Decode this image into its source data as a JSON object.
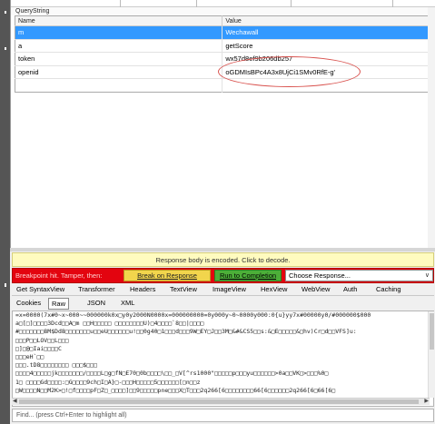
{
  "querystring": {
    "title": "QueryString",
    "columns": [
      "Name",
      "Value"
    ],
    "rows": [
      {
        "name": "m",
        "value": "Wechawall",
        "selected": true
      },
      {
        "name": "a",
        "value": "getScore",
        "selected": false
      },
      {
        "name": "token",
        "value": "wx57d8ef9b206db257",
        "selected": false
      },
      {
        "name": "openid",
        "value": "oGDMIsBPc4A3x8UjCi1SMv0RfE-g'",
        "selected": false
      }
    ]
  },
  "encoded_bar": {
    "label": "Response body is encoded. Click to decode."
  },
  "breakpoint": {
    "status_text": "Breakpoint hit. Tamper, then:",
    "break_label": "Break on Response",
    "run_label": "Run to Completion",
    "choose_label": "Choose Response..."
  },
  "tabs_row1": [
    "Get SyntaxView",
    "Transformer",
    "Headers",
    "TextView",
    "ImageView",
    "HexView",
    "WebView",
    "Auth",
    "Caching"
  ],
  "tabs_row2": [
    "Cookies",
    "Raw",
    "JSON",
    "XML"
  ],
  "selected_tab": "Raw",
  "raw_lines": [
    "=x=0000(7x#0~x~000~~000000k0x□y0y2000N0000x=000000000=0y000y~0~0000y000:0{u}yy7x#00000y0/#000000$000",
    "a□[□]□□□□3Dcd□□A□m □□H□□□□□ □□□□□□□□U)□4□□□□`8□□|□□□□",
    "#□□□□□□□8M$Dd8□□□□□□□u□□eU□□□□□□u!□□0g40□1□□□d□□□9W□EY□J□□3M□&#&CS5□□s:&□E□□□□□&□hv)Cr□d□□VFS]u:",
    "□□□P□□LOV□□L□□□",
    "□]□@□Iai□□□□C",
    "□□□eH`□□",
    "□□□.tD8□□□□□□□□ □□□$□□□",
    "□□□□4□□□□□jk□□□□□□□/□□□□L□g□fN□E70□0b□□□□\\□□_□V[^rs1000\"□□□□□p□□□yu□□□□□□>0a□□VK□>□□□%0□",
    "1□ □□□□Gd□□□□:□G□□□□9ch□I□A}□-□□□H□□□□□5□□□□□□[□n□□z",
    "□W□□□□N□□M2K>□!□f□□□□pF□Z□_□□□□]□□9□□□□□pne□□□X□T□□□2q266[6□□□□□□□□66[6□□□□□□2q266[6□66[6□"
  ],
  "findbar": {
    "placeholder": "Find... (press Ctrl+Enter to highlight all)"
  },
  "colors": {
    "selected_row": "#3399ff",
    "breakpoint_bar": "#e3040f",
    "break_button": "#f2d54c",
    "run_button": "#4caf38",
    "encoded_bar": "#fffbbf",
    "annotation": "#d9534f"
  }
}
